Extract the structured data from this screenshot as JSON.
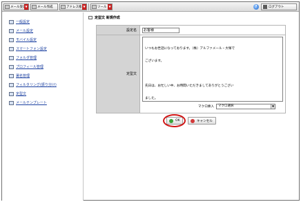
{
  "toolbar": {
    "items": [
      {
        "label": "メール受信"
      },
      {
        "label": "メール作成"
      },
      {
        "label": "アドレス帳"
      },
      {
        "label": "ツール"
      }
    ],
    "logout_label": "ログアウト"
  },
  "sidebar": {
    "items": [
      {
        "label": "一般設定"
      },
      {
        "label": "メール設定"
      },
      {
        "label": "モバイル設定"
      },
      {
        "label": "スマートフォン設定"
      },
      {
        "label": "フォルダ管理"
      },
      {
        "label": "プロフィール管理"
      },
      {
        "label": "署名管理"
      },
      {
        "label": "フィルタリング(振り分け)"
      },
      {
        "label": "定型文"
      },
      {
        "label": "メールテンプレート"
      }
    ]
  },
  "main": {
    "title": "定型文 新規作成",
    "name_label": "設定名",
    "name_value": "お客様",
    "body_label": "定型文",
    "body_lines": [
      "いつもお世話になっております。（株）アルファメール・大塚で",
      "ございます。",
      "",
      "先日は、お忙しい中、お時間いただきましてありがとうござい",
      "ました。"
    ],
    "macro_label": "マクロ挿入",
    "macro_selected": "マクロ選択",
    "ok_label": "OK",
    "cancel_label": "キャンセル"
  }
}
